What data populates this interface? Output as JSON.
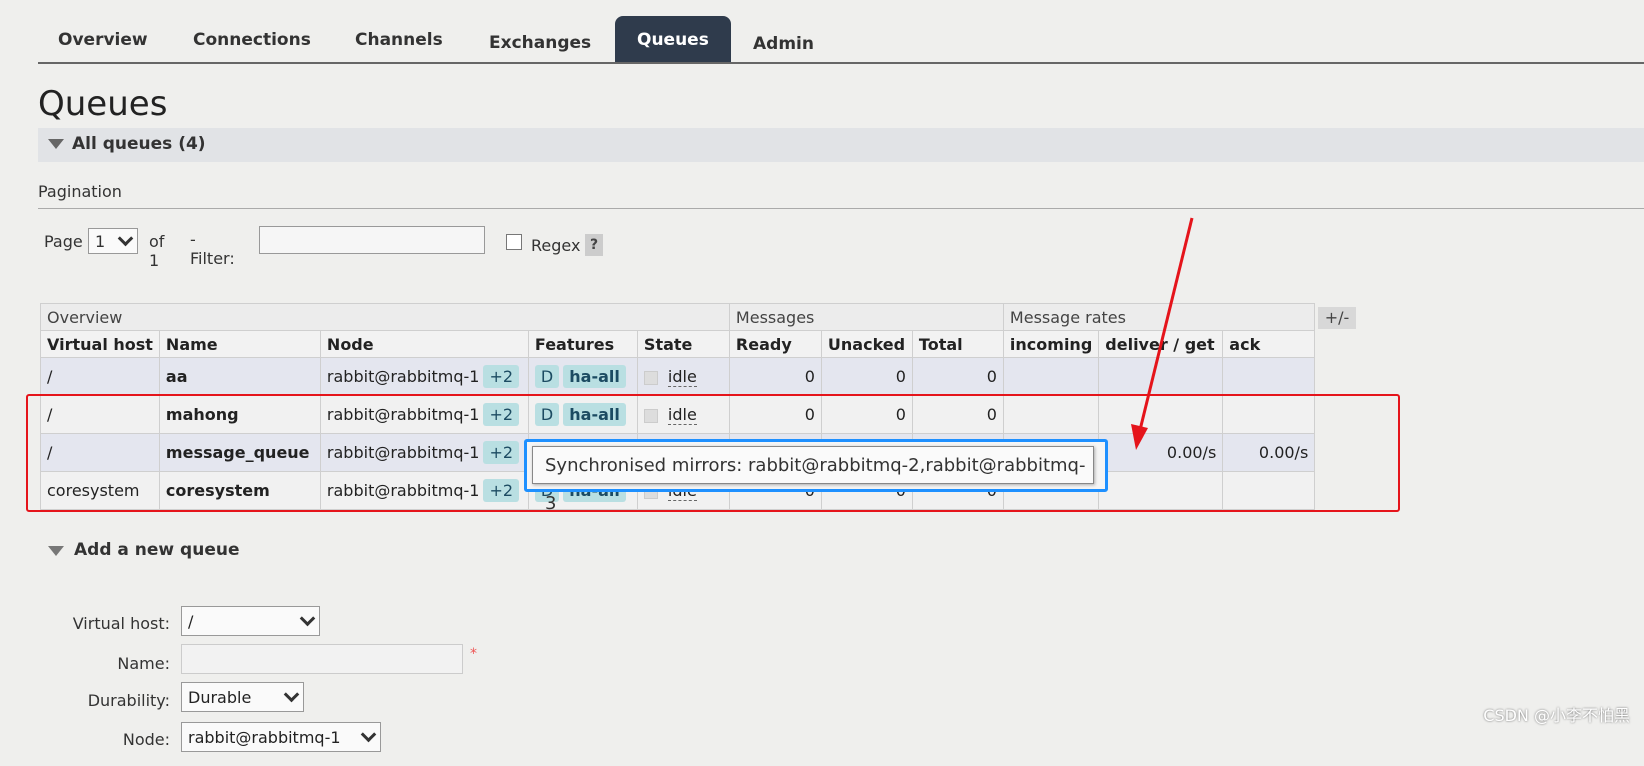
{
  "nav": {
    "tabs": [
      {
        "label": "Overview",
        "active": false
      },
      {
        "label": "Connections",
        "active": false
      },
      {
        "label": "Channels",
        "active": false
      },
      {
        "label": "Exchanges",
        "active": false
      },
      {
        "label": "Queues",
        "active": true
      },
      {
        "label": "Admin",
        "active": false
      }
    ]
  },
  "page_title": "Queues",
  "section_title": "All queues (4)",
  "pagination": {
    "label": "Pagination",
    "page_label": "Page",
    "page_value": "1",
    "of_label": "of 1",
    "filter_label": "- Filter:",
    "filter_value": "",
    "regex_label": "Regex",
    "help_label": "?"
  },
  "table": {
    "groups": {
      "overview": "Overview",
      "messages": "Messages",
      "rates": "Message rates"
    },
    "columns": {
      "vhost": "Virtual host",
      "name": "Name",
      "node": "Node",
      "features": "Features",
      "state": "State",
      "ready": "Ready",
      "unacked": "Unacked",
      "total": "Total",
      "incoming": "incoming",
      "deliver": "deliver / get",
      "ack": "ack"
    },
    "toggle_label": "+/-",
    "rows": [
      {
        "vhost": "/",
        "name": "aa",
        "node": "rabbit@rabbitmq-1",
        "mirrors": "+2",
        "feat_d": "D",
        "feat_policy": "ha-all",
        "state": "idle",
        "ready": "0",
        "unacked": "0",
        "total": "0",
        "incoming": "",
        "deliver": "",
        "ack": ""
      },
      {
        "vhost": "/",
        "name": "mahong",
        "node": "rabbit@rabbitmq-1",
        "mirrors": "+2",
        "feat_d": "D",
        "feat_policy": "ha-all",
        "state": "idle",
        "ready": "0",
        "unacked": "0",
        "total": "0",
        "incoming": "",
        "deliver": "",
        "ack": ""
      },
      {
        "vhost": "/",
        "name": "message_queue",
        "node": "rabbit@rabbitmq-1",
        "mirrors": "+2",
        "feat_d": "",
        "feat_policy": "",
        "state": "",
        "ready": "",
        "unacked": "",
        "total": "",
        "incoming": "",
        "deliver": "0.00/s",
        "ack": "0.00/s"
      },
      {
        "vhost": "coresystem",
        "name": "coresystem",
        "node": "rabbit@rabbitmq-1",
        "mirrors": "+2",
        "feat_d": "D",
        "feat_policy": "ha-all",
        "state": "idle",
        "ready": "0",
        "unacked": "0",
        "total": "0",
        "incoming": "",
        "deliver": "",
        "ack": ""
      }
    ]
  },
  "tooltip": "Synchronised mirrors: rabbit@rabbitmq-2,rabbit@rabbitmq-3",
  "add_queue": {
    "title": "Add a new queue",
    "vhost_label": "Virtual host:",
    "vhost_value": "/",
    "name_label": "Name:",
    "name_value": "",
    "required_mark": "*",
    "durability_label": "Durability:",
    "durability_value": "Durable",
    "node_label": "Node:",
    "node_value": "rabbit@rabbitmq-1"
  },
  "watermark": "CSDN @小李不怕黑",
  "colors": {
    "annotation_red": "#e5141b",
    "annotation_blue": "#1e90ff",
    "active_tab": "#2f3b4c",
    "badge": "#b9dfe2"
  }
}
